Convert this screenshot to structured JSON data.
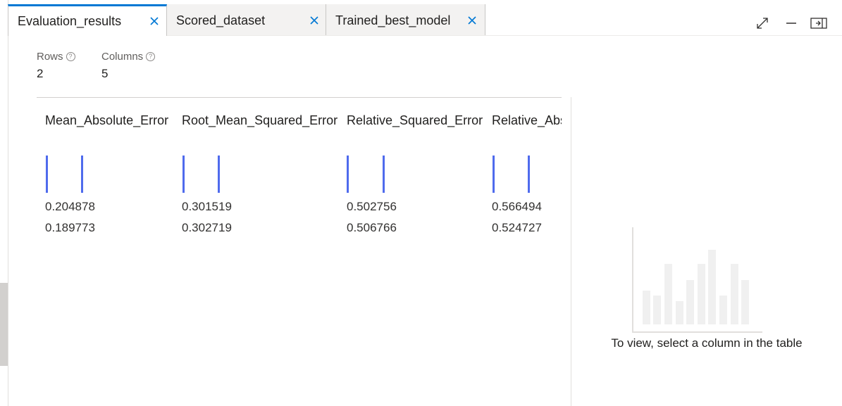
{
  "tabs": [
    {
      "label": "Evaluation_results",
      "active": true
    },
    {
      "label": "Scored_dataset",
      "active": false
    },
    {
      "label": "Trained_best_model",
      "active": false
    }
  ],
  "stats": {
    "rows_label": "Rows",
    "rows_value": "2",
    "columns_label": "Columns",
    "columns_value": "5"
  },
  "table": {
    "columns": [
      "Mean_Absolute_Error",
      "Root_Mean_Squared_Error",
      "Relative_Squared_Error",
      "Relative_Abs"
    ],
    "rows": [
      [
        "0.204878",
        "0.301519",
        "0.502756",
        "0.566494"
      ],
      [
        "0.189773",
        "0.302719",
        "0.506766",
        "0.524727"
      ]
    ]
  },
  "placeholder": {
    "text": "To view, select a column in the table"
  },
  "colors": {
    "accent": "#0078d4",
    "bar": "#4f6bed"
  },
  "icons": [
    "close-icon",
    "expand-icon",
    "minimize-icon",
    "dock-panel-icon",
    "help-icon"
  ]
}
